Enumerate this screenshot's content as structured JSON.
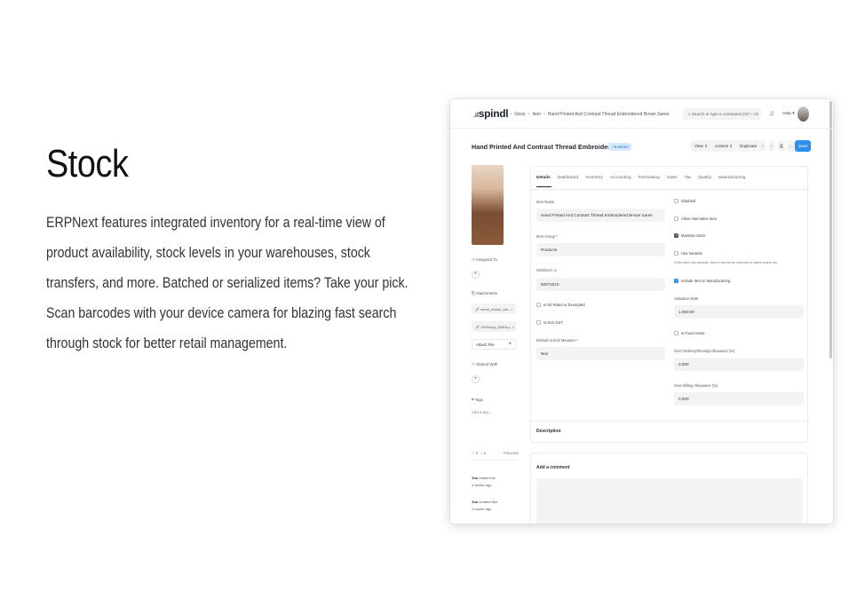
{
  "hero": {
    "title": "Stock",
    "body": "ERPNext features integrated inventory for a real-time view of product availability, stock levels in your warehouses, stock transfers, and more. Batched or serialized items? Take your pick. Scan barcodes with your device camera for blazing fast search through stock for better retail management."
  },
  "app": {
    "logo": "spindl",
    "breadcrumb": [
      "Stock",
      "Item",
      "Hand Printed And Contrast Thread Embroidered Brown Saree"
    ],
    "search_placeholder": "Search or type a command (Ctrl + G)",
    "help_label": "Help",
    "bell_icon": "bell-icon"
  },
  "doc": {
    "title": "Hand Printed And Contrast Thread Embroidered ...",
    "status": "Enabled",
    "buttons": {
      "view": "View",
      "actions": "Actions",
      "duplicate": "Duplicate",
      "save": "Save"
    }
  },
  "sidebar": {
    "assigned_to": "Assigned To",
    "attachments": "Attachments",
    "attachment_files": [
      "ochre_brown_sar.. ×",
      "1020copy_5260c.j.. ×"
    ],
    "attach_file": "Attach File",
    "shared_with": "Shared With",
    "tags": "Tags",
    "add_tag": "Add a tag ..."
  },
  "tabs": [
    "Details",
    "Dashboard",
    "Inventory",
    "Accounting",
    "Purchasing",
    "Sales",
    "Tax",
    "Quality",
    "Manufacturing"
  ],
  "form": {
    "item_name_label": "Item Name",
    "item_name_value": "Hand Printed And Contrast Thread Embroidered Brown Saree",
    "item_group_label": "Item Group *",
    "item_group_value": "Products",
    "hsn_label": "HSN/SAC",
    "hsn_value": "50072010",
    "nil_rated_label": "Is Nil Rated or Exempted",
    "non_gst_label": "Is Non GST",
    "uom_label": "Default Unit of Measure *",
    "uom_value": "Nos",
    "disabled_label": "Disabled",
    "allow_alt_label": "Allow Alternative Item",
    "maintain_stock_label": "Maintain Stock",
    "has_variants_label": "Has Variants",
    "variants_help": "If this item has variants, then it cannot be selected in sales orders etc.",
    "include_mfg_label": "Include Item In Manufacturing",
    "valuation_rate_label": "Valuation Rate",
    "valuation_rate_value": "1,000.00",
    "fixed_asset_label": "Is Fixed Asset",
    "over_delivery_label": "Over Delivery/Receipt Allowance (%)",
    "over_delivery_value": "0.000",
    "over_billing_label": "Over Billing Allowance (%)",
    "over_billing_value": "0.000"
  },
  "description_label": "Description",
  "comment_title": "Add a comment",
  "activity": {
    "counts": "♡ 0 · ○ 0",
    "follow": "FOLLOW",
    "edit_user": "You",
    "edit_text": "edited this",
    "edit_time": "4 weeks ago",
    "create_user": "You",
    "create_text": "created this",
    "create_time": "1 month ago"
  },
  "colors": {
    "primary": "#2f8fea",
    "badge_bg": "#d6e9fb",
    "input_bg": "#f3f3f3"
  }
}
